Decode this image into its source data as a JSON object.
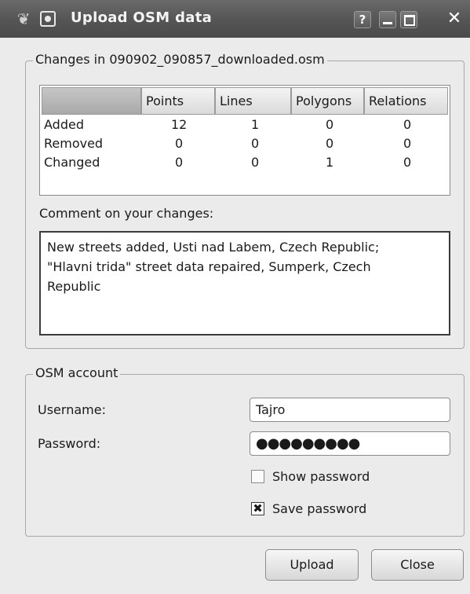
{
  "window": {
    "title": "Upload OSM data",
    "help_glyph": "?",
    "close_glyph": "✕",
    "wm_glyph": "❦"
  },
  "changes_group": {
    "title": "Changes in 090902_090857_downloaded.osm",
    "table": {
      "columns": [
        "",
        "Points",
        "Lines",
        "Polygons",
        "Relations"
      ],
      "rows": [
        {
          "label": "Added",
          "values": [
            "12",
            "1",
            "0",
            "0"
          ]
        },
        {
          "label": "Removed",
          "values": [
            "0",
            "0",
            "0",
            "0"
          ]
        },
        {
          "label": "Changed",
          "values": [
            "0",
            "0",
            "1",
            "0"
          ]
        }
      ]
    },
    "comment_label": "Comment on your changes:",
    "comment_lines": [
      "New streets added, Usti nad Labem, Czech Republic;",
      "\"Hlavni trida\" street data repaired, Sumperk, Czech",
      "Republic"
    ]
  },
  "account_group": {
    "title": "OSM account",
    "username_label": "Username:",
    "username_value": "Tajro",
    "password_label": "Password:",
    "password_value": "●●●●●●●●●",
    "show_password_label": "Show password",
    "show_password_checked": false,
    "save_password_label": "Save password",
    "save_password_checked": true,
    "check_glyph": "✖"
  },
  "buttons": {
    "upload": "Upload",
    "close": "Close"
  }
}
